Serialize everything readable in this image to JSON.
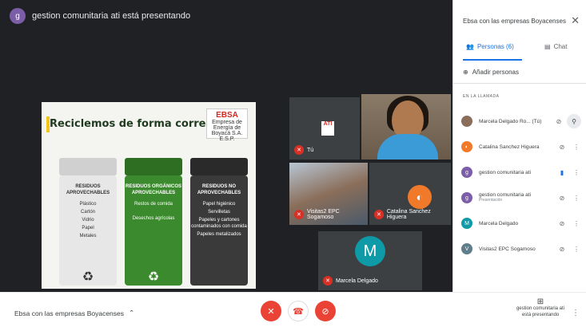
{
  "presenter_banner": {
    "avatar_letter": "g",
    "text": "gestion comunitaria ati está presentando"
  },
  "slide": {
    "title": "Reciclemos de forma correcta",
    "logo_name": "EBSA",
    "logo_sub": "Empresa de Energía de Boyacá S.A. E.S.P.",
    "bins": [
      {
        "title": "RESIDUOS APROVECHABLES",
        "items": [
          "Plástico",
          "Cartón",
          "Vidrio",
          "Papel",
          "Metales"
        ]
      },
      {
        "title": "RESIDUOS ORGÁNICOS APROVECHABLES",
        "items": [
          "Restos de comida",
          "Desechos agrícolas"
        ]
      },
      {
        "title": "RESIDUOS NO APROVECHABLES",
        "items": [
          "Papel higiénico",
          "Servilletas",
          "Papeles y cartones contaminados con comida",
          "Papeles metalizados"
        ]
      }
    ]
  },
  "tiles": {
    "you": "Tú",
    "visitas": "Visitas2 EPC Sogamoso",
    "catalina": "Catalina Sanchez Higuera",
    "marcela": "Marcela Delgado",
    "marcela_letter": "M"
  },
  "panel": {
    "title": "Ebsa con las empresas Boyacenses",
    "tab_people": "Personas (6)",
    "tab_chat": "Chat",
    "add_people": "Añadir personas",
    "section": "EN LA LLAMADA",
    "people": [
      {
        "name": "Marcela Delgado Ro... (Tú)",
        "sub": "",
        "letter": "",
        "color": "#8a6e5a"
      },
      {
        "name": "Catalina Sanchez Higuera",
        "sub": "",
        "letter": "",
        "color": "#f07a2a"
      },
      {
        "name": "gestion comunitaria ati",
        "sub": "",
        "letter": "g",
        "color": "#7b5ea7"
      },
      {
        "name": "gestion comunitaria ati",
        "sub": "Presentación",
        "letter": "g",
        "color": "#7b5ea7"
      },
      {
        "name": "Marcela Delgado",
        "sub": "",
        "letter": "M",
        "color": "#0f9aa8"
      },
      {
        "name": "Visitas2 EPC Sogamoso",
        "sub": "",
        "letter": "V",
        "color": "#607d8b"
      }
    ]
  },
  "bottom": {
    "meeting_title": "Ebsa con las empresas Boyacenses",
    "present_label": "gestion comunitaria ati está presentando"
  }
}
